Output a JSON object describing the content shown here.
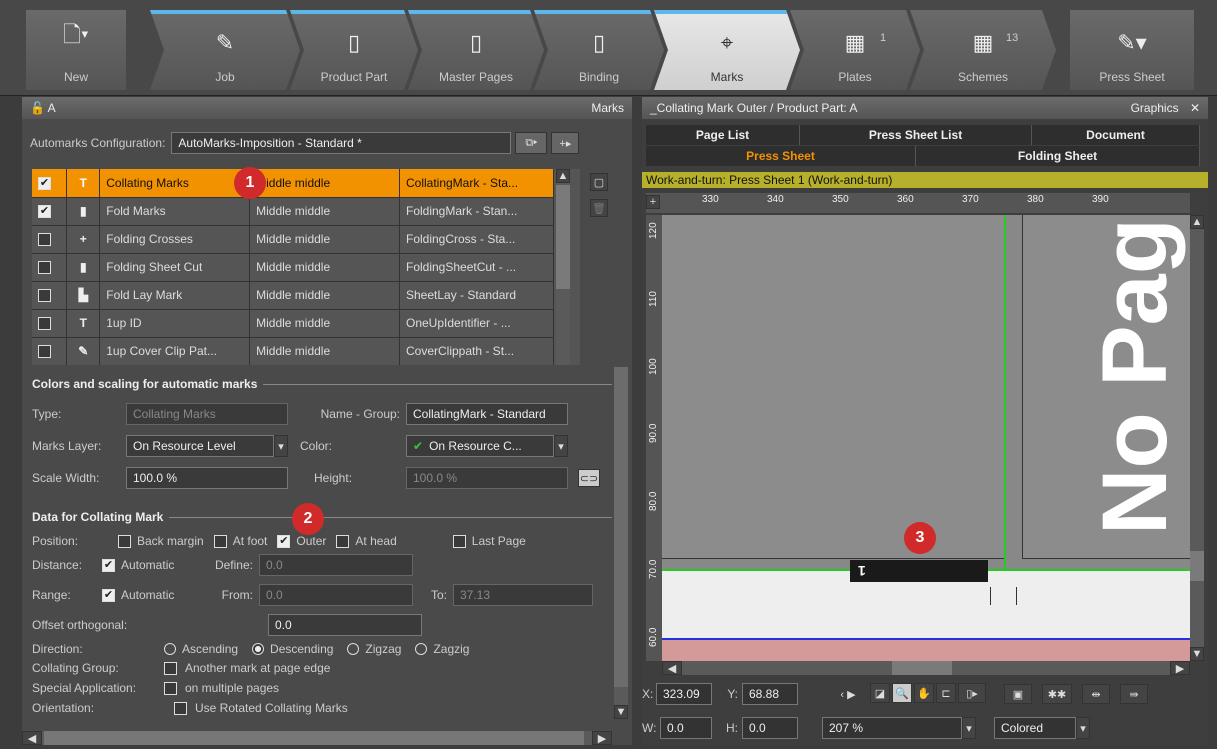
{
  "toolbar": {
    "new_label": "New",
    "steps": [
      {
        "label": "Job",
        "icon": "job-icon"
      },
      {
        "label": "Product Part",
        "icon": "product-part-icon"
      },
      {
        "label": "Master Pages",
        "icon": "master-pages-icon"
      },
      {
        "label": "Binding",
        "icon": "binding-icon"
      },
      {
        "label": "Marks",
        "icon": "marks-icon",
        "active": true
      },
      {
        "label": "Plates",
        "icon": "plates-icon",
        "count": "1"
      },
      {
        "label": "Schemes",
        "icon": "schemes-icon",
        "count": "13"
      }
    ],
    "press_sheet_label": "Press Sheet"
  },
  "left_panel": {
    "title_left": "A",
    "title_right": "Marks",
    "automarks_label": "Automarks Configuration:",
    "automarks_value": "AutoMarks-Imposition - Standard *",
    "rows": [
      {
        "checked": true,
        "type_icon": "T",
        "name": "Collating Marks",
        "position": "Middle middle",
        "resource": "CollatingMark - Sta...",
        "selected": true
      },
      {
        "checked": true,
        "type_icon": "▮",
        "name": "Fold Marks",
        "position": "Middle middle",
        "resource": "FoldingMark - Stan..."
      },
      {
        "checked": false,
        "type_icon": "+",
        "name": "Folding Crosses",
        "position": "Middle middle",
        "resource": "FoldingCross - Sta..."
      },
      {
        "checked": false,
        "type_icon": "▮",
        "name": "Folding Sheet Cut",
        "position": "Middle middle",
        "resource": "FoldingSheetCut - ..."
      },
      {
        "checked": false,
        "type_icon": "▙",
        "name": "Fold Lay Mark",
        "position": "Middle middle",
        "resource": "SheetLay - Standard"
      },
      {
        "checked": false,
        "type_icon": "T",
        "name": "1up ID",
        "position": "Middle middle",
        "resource": "OneUpIdentifier - ..."
      },
      {
        "checked": false,
        "type_icon": "✎",
        "name": "1up Cover Clip Pat...",
        "position": "Middle middle",
        "resource": "CoverClippath - St..."
      }
    ],
    "colors_section": {
      "header": "Colors and scaling for automatic marks",
      "type_label": "Type:",
      "type_value": "Collating Marks",
      "name_group_label": "Name - Group:",
      "name_group_value": "CollatingMark - Standard",
      "marks_layer_label": "Marks Layer:",
      "marks_layer_value": "On Resource Level",
      "color_label": "Color:",
      "color_value": "On Resource C...",
      "scale_width_label": "Scale Width:",
      "scale_width_value": "100.0 %",
      "height_label": "Height:",
      "height_value": "100.0 %"
    },
    "collating_section": {
      "header": "Data for Collating Mark",
      "position_label": "Position:",
      "position_options": [
        {
          "label": "Back margin",
          "checked": false
        },
        {
          "label": "At foot",
          "checked": false
        },
        {
          "label": "Outer",
          "checked": true
        },
        {
          "label": "At head",
          "checked": false
        },
        {
          "label": "Last Page",
          "checked": false
        }
      ],
      "distance_label": "Distance:",
      "distance_auto": "Automatic",
      "define_label": "Define:",
      "define_value": "0.0",
      "range_label": "Range:",
      "range_auto": "Automatic",
      "from_label": "From:",
      "from_value": "0.0",
      "to_label": "To:",
      "to_value": "37.13",
      "offset_label": "Offset orthogonal:",
      "offset_value": "0.0",
      "direction_label": "Direction:",
      "directions": [
        {
          "label": "Ascending",
          "selected": false
        },
        {
          "label": "Descending",
          "selected": true
        },
        {
          "label": "Zigzag",
          "selected": false
        },
        {
          "label": "Zagzig",
          "selected": false
        }
      ],
      "collating_group_label": "Collating Group:",
      "collating_group_option": "Another mark at page edge",
      "special_label": "Special Application:",
      "special_option": "on multiple pages",
      "orientation_label": "Orientation:",
      "orientation_option": "Use Rotated Collating Marks"
    }
  },
  "right_panel": {
    "title": "_Collating Mark Outer / Product Part: A",
    "title_right": "Graphics",
    "tabs_row1": [
      "Page List",
      "Press Sheet List",
      "Document"
    ],
    "tabs_row2": [
      "Press Sheet",
      "Folding Sheet"
    ],
    "sheet_info": "Work-and-turn: Press Sheet 1 (Work-and-turn)",
    "ruler_top": [
      "330",
      "340",
      "350",
      "360",
      "370",
      "380",
      "390"
    ],
    "ruler_left": [
      "120",
      "110",
      "100",
      "90.0",
      "80.0",
      "70.0",
      "60.0"
    ],
    "page_text": "No Pag",
    "mark_text": "1",
    "x_label": "X:",
    "x_value": "323.09",
    "y_label": "Y:",
    "y_value": "68.88",
    "w_label": "W:",
    "w_value": "0.0",
    "h_label": "H:",
    "h_value": "0.0",
    "zoom": "207 %",
    "view_mode": "Colored"
  },
  "callouts": [
    "1",
    "2",
    "3"
  ],
  "colors": {
    "accent": "#f39200",
    "callout": "#d12a2a",
    "guide_green": "#22cc22",
    "guide_blue": "#2233dd",
    "info_bar": "#b6b02a"
  }
}
